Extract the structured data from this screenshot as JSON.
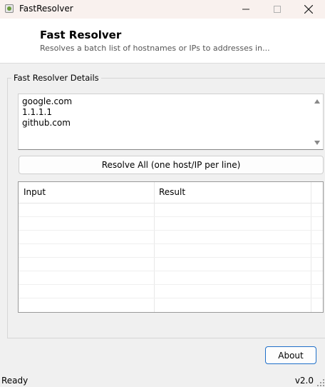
{
  "window": {
    "title": "FastResolver"
  },
  "header": {
    "title": "Fast Resolver",
    "subtitle": "Resolves a batch list of hostnames or IPs to addresses in..."
  },
  "group": {
    "label": "Fast Resolver Details"
  },
  "hosts_input": {
    "value": "google.com\n1.1.1.1\ngithub.com"
  },
  "resolve_button": {
    "label": "Resolve All (one host/IP per line)"
  },
  "results_table": {
    "columns": [
      "Input",
      "Result"
    ],
    "rows": []
  },
  "about_button": {
    "label": "About"
  },
  "statusbar": {
    "status": "Ready",
    "version": "v2.0"
  },
  "colors": {
    "accent": "#1f6fc9",
    "titlebar": "#f9f1ee"
  },
  "icons": [
    "app-icon",
    "minimize-icon",
    "maximize-icon",
    "close-icon",
    "scroll-up-arrow-icon",
    "scroll-down-arrow-icon",
    "resize-grip-icon"
  ]
}
